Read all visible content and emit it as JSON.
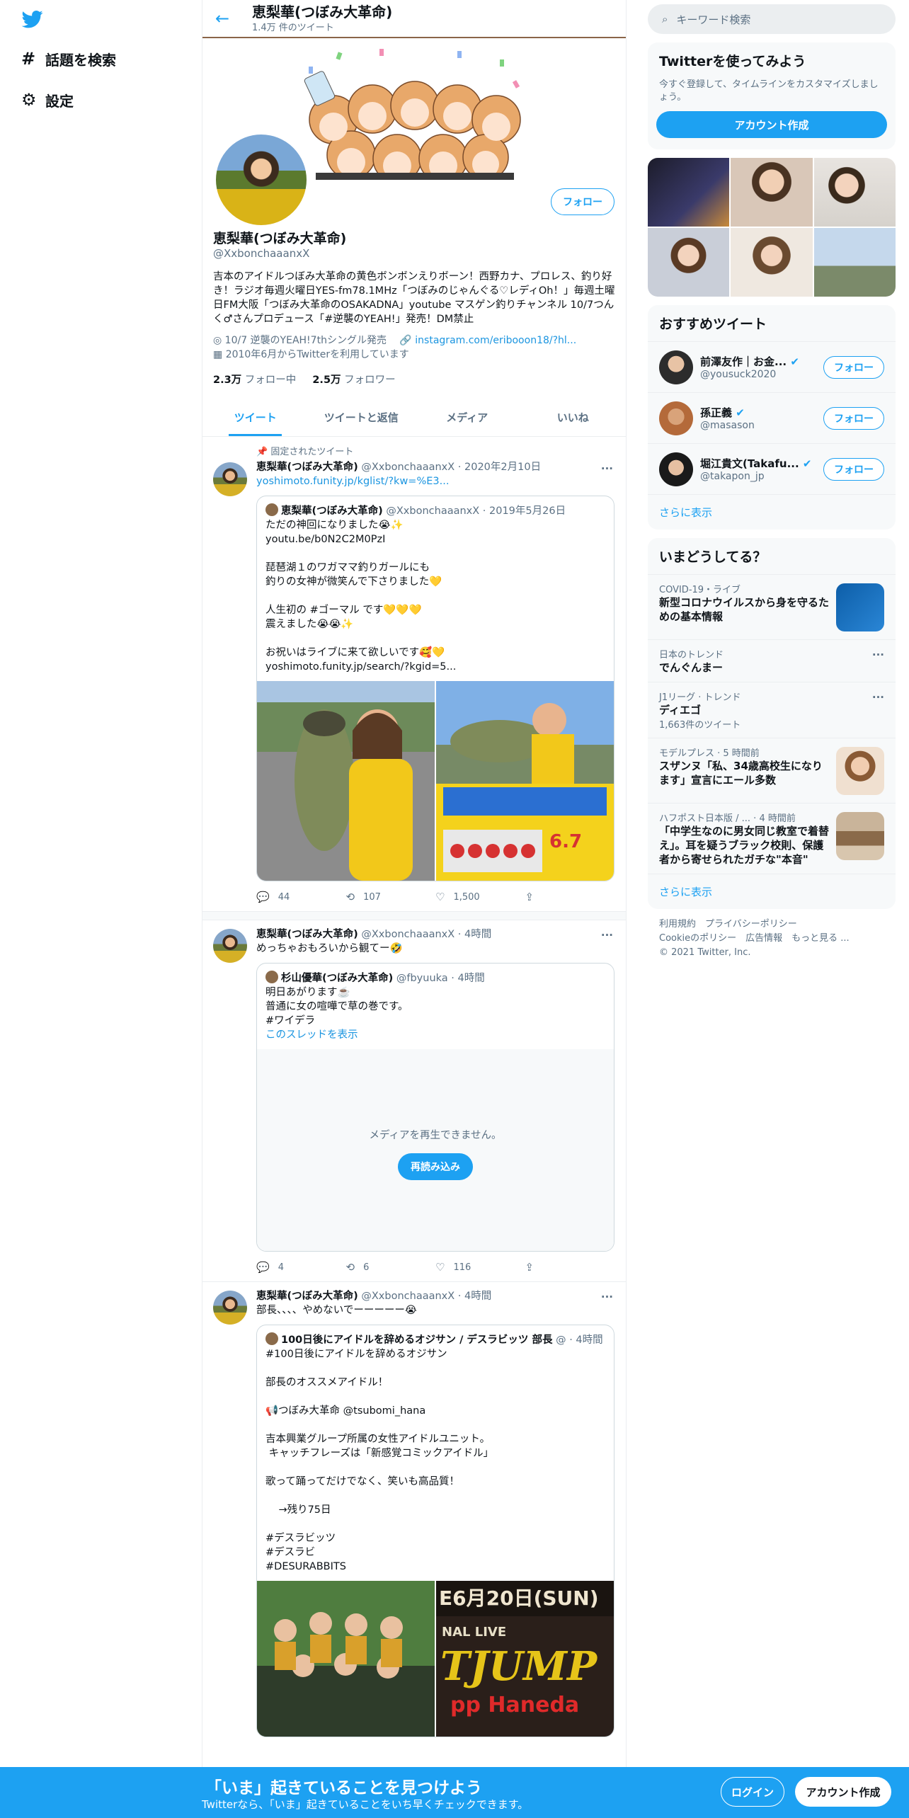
{
  "nav": {
    "explore": "話題を検索",
    "settings": "設定"
  },
  "header": {
    "name": "恵梨華(つぼみ大革命)",
    "count": "1.4万 件のツイート"
  },
  "profile": {
    "name": "恵梨華(つぼみ大革命)",
    "handle": "@XxbonchaaanxX",
    "follow": "フォロー",
    "bio": "吉本のアイドルつぼみ大革命の黄色ボンボンえりボーン！西野カナ、プロレス、釣り好き！ラジオ毎週火曜日YES-fm78.1MHz「つぼみのじゃんぐる♡レディOh！」毎週土曜日FM大阪「つぼみ大革命のOSAKADNA」youtube マスゲン釣りチャンネル 10/7つんく♂さんプロデュース「#逆襲のYEAH!」発売！DM禁止",
    "location": "10/7 逆襲のYEAH!7thシングル発売",
    "link": "instagram.com/eribooon18/?hl...",
    "joined": "2010年6月からTwitterを利用しています",
    "following_count": "2.3万",
    "following_label": "フォロー中",
    "followers_count": "2.5万",
    "followers_label": "フォロワー"
  },
  "tabs": [
    "ツイート",
    "ツイートと返信",
    "メディア",
    "いいね"
  ],
  "tweets": [
    {
      "pinned": "固定されたツイート",
      "name": "恵梨華(つぼみ大革命)",
      "handle": "@XxbonchaaanxX · 2020年2月10日",
      "text": "yoshimoto.funity.jp/kglist/?kw=%E3...",
      "quote": {
        "name": "恵梨華(つぼみ大革命)",
        "handle": "@XxbonchaaanxX · 2019年5月26日",
        "text": "ただの神回になりました😭✨\nyoutu.be/b0N2C2M0PzI\n\n琵琶湖１のワガママ釣りガールにも\n釣りの女神が微笑んで下さりました💛\n\n人生初の #ゴーマル です💛💛💛\n震えました😭😭✨\n\nお祝いはライブに来て欲しいです🥰💛\nyoshimoto.funity.jp/search/?kgid=5..."
      },
      "replies": "44",
      "retweets": "107",
      "likes": "1,500"
    },
    {
      "name": "恵梨華(つぼみ大革命)",
      "handle": "@XxbonchaaanxX · 4時間",
      "text": "めっちゃおもろいから観てー🤣",
      "quote": {
        "name": "杉山優華(つぼみ大革命)",
        "handle": "@fbyuuka · 4時間",
        "text": "明日あがります☕️\n普通に女の喧嘩で草の巻です。\n#ワイデラ",
        "thread": "このスレッドを表示",
        "media_error": "メディアを再生できません。",
        "reload": "再読み込み"
      },
      "replies": "4",
      "retweets": "6",
      "likes": "116"
    },
    {
      "name": "恵梨華(つぼみ大革命)",
      "handle": "@XxbonchaaanxX · 4時間",
      "text": "部長、、、、やめないでーーーーー😭",
      "quote": {
        "name": "100日後にアイドルを辞めるオジサン / デスラビッツ 部長",
        "handle": "@ · 4時間",
        "text": "#100日後にアイドルを辞めるオジサン\n\n部長のオススメアイドル！\n\n📢つぼみ大革命 @tsubomi_hana\n\n吉本興業グループ所属の女性アイドルユニット。\n キャッチフレーズは「新感覚コミックアイドル」\n\n歌って踊ってだけでなく、笑いも高品質！\n\n    →残り75日\n\n#デスラビッツ\n#デスラビ\n#DESURABBITS"
      }
    }
  ],
  "right": {
    "search_placeholder": "キーワード検索",
    "signup_title": "Twitterを使ってみよう",
    "signup_sub": "今すぐ登録して、タイムラインをカスタマイズしましょう。",
    "signup_btn": "アカウント作成",
    "recommend_title": "おすすめツイート",
    "who": [
      {
        "name": "前澤友作｜お金...",
        "handle": "@yousuck2020",
        "follow": "フォロー"
      },
      {
        "name": "孫正義",
        "handle": "@masason",
        "follow": "フォロー"
      },
      {
        "name": "堀江貴文(Takafu...",
        "handle": "@takapon_jp",
        "follow": "フォロー"
      }
    ],
    "show_more": "さらに表示",
    "trends_title": "いまどうしてる？",
    "trends": [
      {
        "cat": "COVID-19・ライブ",
        "title": "新型コロナウイルスから身を守るための基本情報"
      },
      {
        "cat": "日本のトレンド",
        "title": "でんぐんまー"
      },
      {
        "cat": "J1リーグ · トレンド",
        "title": "ディエゴ",
        "count": "1,663件のツイート"
      },
      {
        "cat": "モデルプレス · 5 時間前",
        "title": "スザンヌ「私、34歳高校生になります」宣言にエール多数"
      },
      {
        "cat": "ハフポスト日本版 / ... · 4 時間前",
        "title": "「中学生なのに男女同じ教室で着替え」。耳を疑うブラック校則、保護者から寄せられたガチな\"本音\""
      }
    ],
    "show_more2": "さらに表示",
    "footer1": "利用規約　プライバシーポリシー",
    "footer2": "Cookieのポリシー　広告情報　もっと見る ...",
    "footer3": "© 2021 Twitter, Inc."
  },
  "bottom": {
    "title": "「いま」起きていることを見つけよう",
    "sub": "Twitterなら、「いま」起きていることをいち早くチェックできます。",
    "login": "ログイン",
    "signup": "アカウント作成"
  },
  "colors": {
    "accent": "#1da1f2"
  }
}
